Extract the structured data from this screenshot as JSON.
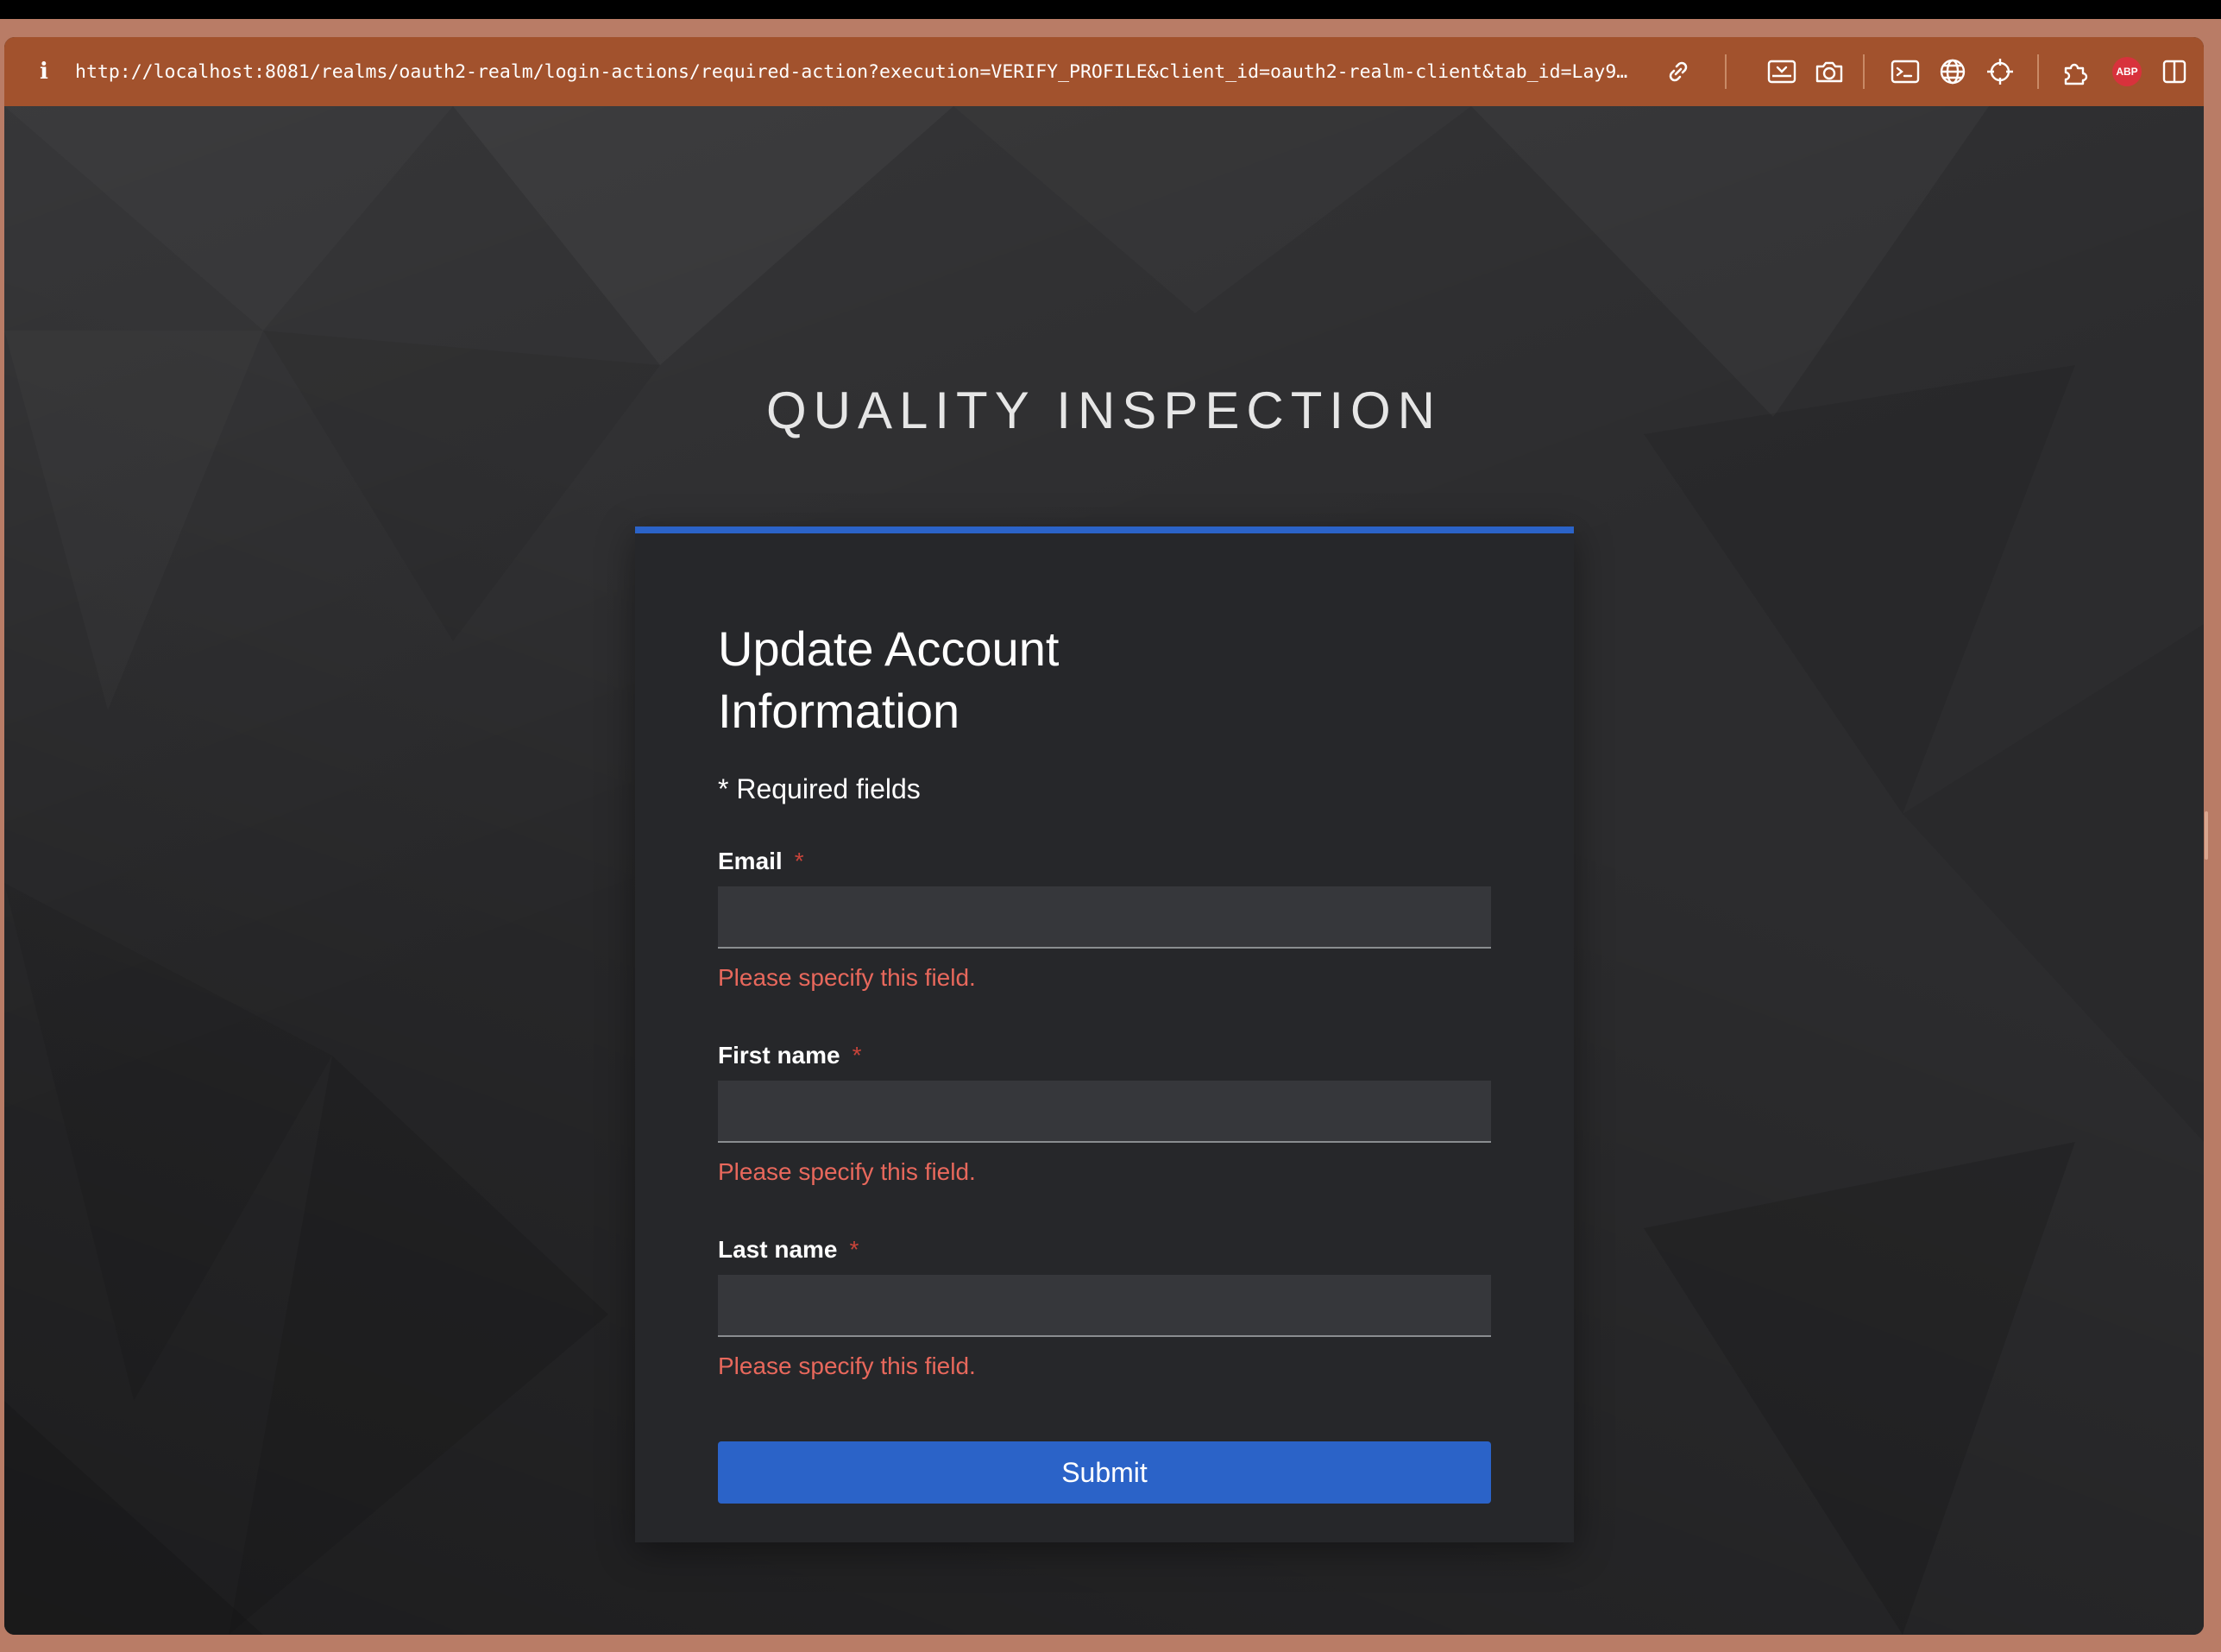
{
  "browser": {
    "url": "http://localhost:8081/realms/oauth2-realm/login-actions/required-action?execution=VERIFY_PROFILE&client_id=oauth2-realm-client&tab_id=Lay9…",
    "info_glyph": "i",
    "abp_label": "ABP",
    "icons": [
      "link-icon",
      "screenshot-icon",
      "camera-icon",
      "terminal-icon",
      "globe-icon",
      "crosshair-icon",
      "extensions-icon",
      "adblock-icon",
      "sidebar-icon"
    ]
  },
  "page": {
    "brand": "QUALITY INSPECTION",
    "title": "Update Account Information",
    "required_note": "* Required fields",
    "fields": [
      {
        "label": "Email",
        "required_mark": "*",
        "value": "",
        "error": "Please specify this field."
      },
      {
        "label": "First name",
        "required_mark": "*",
        "value": "",
        "error": "Please specify this field."
      },
      {
        "label": "Last name",
        "required_mark": "*",
        "value": "",
        "error": "Please specify this field."
      }
    ],
    "submit_label": "Submit"
  },
  "colors": {
    "accent": "#2b63c8",
    "error": "#e8685c",
    "url_bar": "#a2522d",
    "card": "#26272a"
  }
}
